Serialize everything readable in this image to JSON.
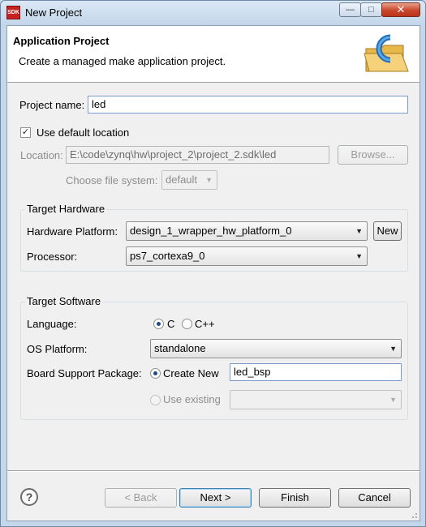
{
  "window": {
    "title": "New Project",
    "app_icon_text": "SDK",
    "minimize_glyph": "—",
    "maximize_glyph": "□",
    "close_glyph": "✕"
  },
  "banner": {
    "title": "Application Project",
    "description": "Create a managed make application project.",
    "icon": "c-project-folder-icon"
  },
  "project": {
    "name_label": "Project name:",
    "name_value": "led",
    "use_default_label": "Use default location",
    "use_default_checked": true,
    "location_label": "Location:",
    "location_value": "E:\\code\\zynq\\hw\\project_2\\project_2.sdk\\led",
    "browse_label": "Browse...",
    "filesystem_label": "Choose file system:",
    "filesystem_value": "default"
  },
  "hardware": {
    "group_title": "Target Hardware",
    "platform_label": "Hardware Platform:",
    "platform_value": "design_1_wrapper_hw_platform_0",
    "new_label": "New",
    "processor_label": "Processor:",
    "processor_value": "ps7_cortexa9_0"
  },
  "software": {
    "group_title": "Target Software",
    "language_label": "Language:",
    "lang_c": "C",
    "lang_cpp": "C++",
    "lang_selected": "C",
    "os_label": "OS Platform:",
    "os_value": "standalone",
    "bsp_label": "Board Support Package:",
    "create_new_label": "Create New",
    "bsp_value": "led_bsp",
    "use_existing_label": "Use existing",
    "existing_value": ""
  },
  "footer": {
    "help_glyph": "?",
    "back_label": "< Back",
    "next_label": "Next >",
    "finish_label": "Finish",
    "cancel_label": "Cancel"
  },
  "colors": {
    "accent": "#3c7fb1",
    "icon_blue": "#1e6fb8",
    "icon_folder": "#e8b74a"
  }
}
